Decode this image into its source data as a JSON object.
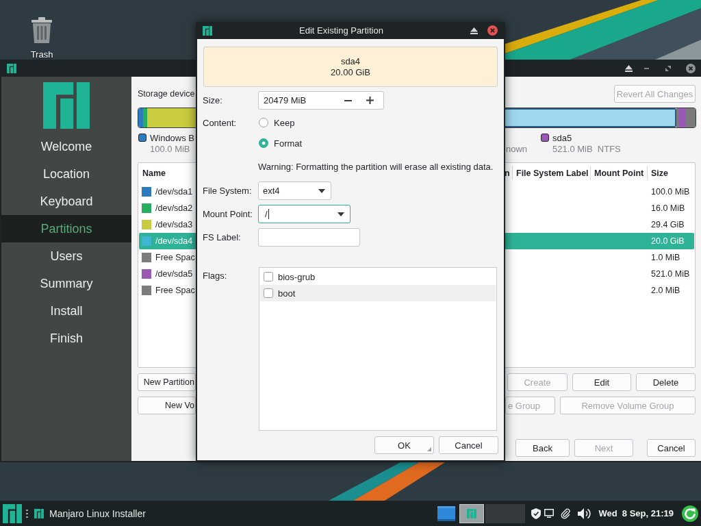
{
  "desktop": {
    "icons": [
      {
        "label": "Trash"
      }
    ]
  },
  "installer": {
    "sidebar": {
      "items": [
        {
          "label": "Welcome",
          "selected": false
        },
        {
          "label": "Location",
          "selected": false
        },
        {
          "label": "Keyboard",
          "selected": false
        },
        {
          "label": "Partitions",
          "selected": true
        },
        {
          "label": "Users",
          "selected": false
        },
        {
          "label": "Summary",
          "selected": false
        },
        {
          "label": "Install",
          "selected": false
        },
        {
          "label": "Finish",
          "selected": false
        }
      ]
    },
    "storage_label": "Storage device",
    "revert_button": {
      "label": "Revert All Changes",
      "disabled": true
    },
    "partition_bar": {
      "segments": [
        {
          "color": "#2c7bbd",
          "selected": false
        },
        {
          "color": "#27ae60",
          "selected": false
        },
        {
          "color": "#c9cc3f",
          "selected": false
        },
        {
          "color": "#a0d8ef",
          "selected": true
        },
        {
          "color": "#7b7b7b",
          "selected": false
        },
        {
          "color": "#9b59b6",
          "selected": false
        },
        {
          "color": "#7b7b7b",
          "selected": false
        }
      ]
    },
    "legend_left": [
      {
        "name": "Windows B",
        "detail": "100.0 MiB",
        "color": "#2c7bbd"
      }
    ],
    "legend_right": [
      {
        "detail": "nown"
      },
      {
        "name": "sda5",
        "detail": "521.0 MiB  NTFS",
        "color": "#9b59b6"
      }
    ],
    "table": {
      "columns_left": [
        "Name"
      ],
      "columns_right": [
        "n",
        "File System Label",
        "Mount Point",
        "Size"
      ],
      "rows": [
        {
          "name": "/dev/sda1",
          "size": "100.0 MiB",
          "color": "#2c7bbd",
          "selected": false
        },
        {
          "name": "/dev/sda2",
          "size": "16.0 MiB",
          "color": "#27ae60",
          "selected": false
        },
        {
          "name": "/dev/sda3",
          "size": "29.4 GiB",
          "color": "#c9cc3f",
          "selected": false
        },
        {
          "name": "/dev/sda4",
          "size": "20.0 GiB",
          "color": "#3fb5d6",
          "selected": true
        },
        {
          "name": "Free Spac",
          "size": "1.0 MiB",
          "color": "#7b7b7b",
          "selected": false
        },
        {
          "name": "/dev/sda5",
          "size": "521.0 MiB",
          "color": "#9b59b6",
          "selected": false
        },
        {
          "name": "Free Spac",
          "size": "2.0 MiB",
          "color": "#7b7b7b",
          "selected": false
        }
      ]
    },
    "button_rows": [
      {
        "left": {
          "label": "New Partition",
          "disabled": false
        },
        "right": [
          {
            "label": "Create",
            "disabled": true
          },
          {
            "label": "Edit",
            "disabled": false
          },
          {
            "label": "Delete",
            "disabled": false
          }
        ]
      },
      {
        "left": {
          "label": "New Vo",
          "disabled": false
        },
        "right": [
          {
            "label": "e Group",
            "disabled": true
          },
          {
            "label": "Remove Volume Group",
            "disabled": true
          }
        ]
      }
    ],
    "nav_buttons": [
      {
        "label": "Back",
        "disabled": false
      },
      {
        "label": "Next",
        "disabled": true
      },
      {
        "label": "Cancel",
        "disabled": false
      }
    ]
  },
  "dialog": {
    "title": "Edit Existing Partition",
    "preview": {
      "name": "sda4",
      "size": "20.00 GiB"
    },
    "size": {
      "label": "Size:",
      "value": "20479 MiB"
    },
    "content": {
      "label": "Content:",
      "options": [
        {
          "label": "Keep",
          "selected": false
        },
        {
          "label": "Format",
          "selected": true
        }
      ]
    },
    "warning": "Warning: Formatting the partition will erase all existing data.",
    "file_system": {
      "label": "File System:",
      "value": "ext4"
    },
    "mount_point": {
      "label": "Mount Point:",
      "value": "/",
      "focused": true
    },
    "fs_label": {
      "label": "FS Label:"
    },
    "flags": {
      "label": "Flags:",
      "items": [
        {
          "label": "bios-grub",
          "checked": false
        },
        {
          "label": "boot",
          "checked": false
        }
      ]
    },
    "buttons": [
      {
        "label": "OK",
        "resize_grip": true
      },
      {
        "label": "Cancel",
        "resize_grip": false
      }
    ]
  },
  "taskbar": {
    "tasks": [
      {
        "label": "Manjaro Linux Installer"
      }
    ],
    "workspaces": [
      {
        "selected": true
      },
      {
        "selected": false
      }
    ],
    "clock": "Wed  8 Sep, 21:19"
  }
}
